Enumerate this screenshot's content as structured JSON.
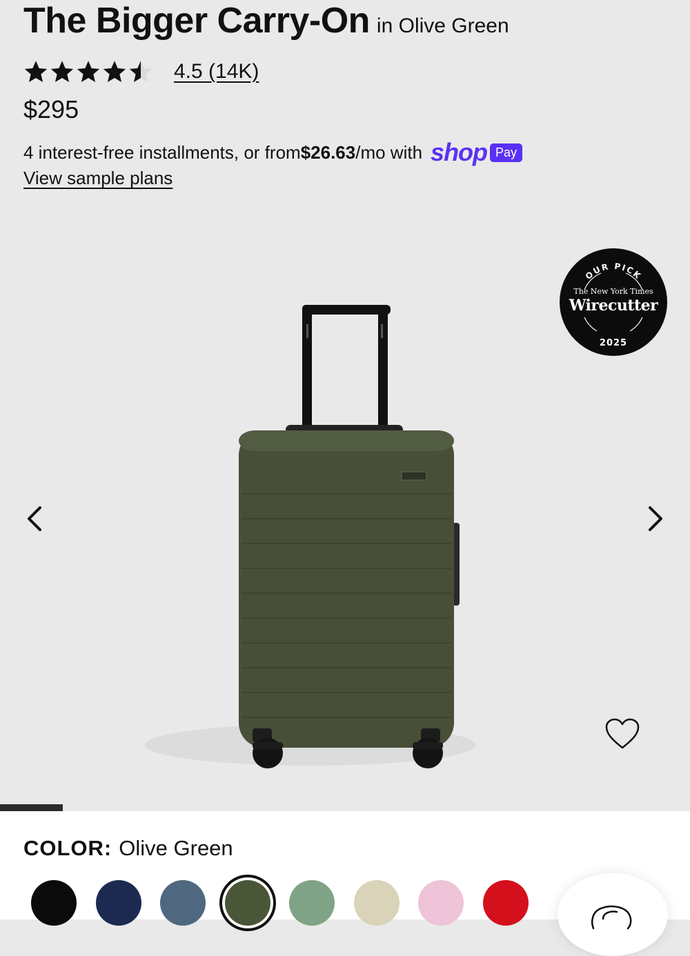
{
  "product": {
    "title": "The Bigger Carry-On",
    "color_suffix": "in Olive Green",
    "rating_value": 4.5,
    "rating_text": "4.5 (14K)",
    "price": "$295"
  },
  "installments": {
    "prefix": "4 interest-free installments, or from ",
    "amount": "$26.63",
    "suffix": "/mo with",
    "shop_word": "shop",
    "pay_badge": "Pay",
    "link": "View sample plans"
  },
  "badge": {
    "arc_top": "OUR PICK",
    "nyt": "The New York Times",
    "name": "Wirecutter",
    "year": "2025"
  },
  "gallery": {
    "current_index": 1,
    "total": 11,
    "prev_icon": "chevron-left-icon",
    "next_icon": "chevron-right-icon",
    "wishlist_icon": "heart-icon",
    "suitcase_color": "#474f38"
  },
  "color_picker": {
    "label": "COLOR:",
    "selected": "Olive Green",
    "swatches": [
      {
        "name": "Black",
        "hex": "#0b0b0b"
      },
      {
        "name": "Navy",
        "hex": "#1c2a52"
      },
      {
        "name": "Slate Blue",
        "hex": "#4f6880"
      },
      {
        "name": "Olive Green",
        "hex": "#4a5638",
        "selected": true
      },
      {
        "name": "Sage",
        "hex": "#7ea386"
      },
      {
        "name": "Sand",
        "hex": "#d9d3b9"
      },
      {
        "name": "Pink",
        "hex": "#efc3d8"
      },
      {
        "name": "Red",
        "hex": "#d4101c"
      }
    ]
  },
  "chat_icon": "chat-icon"
}
